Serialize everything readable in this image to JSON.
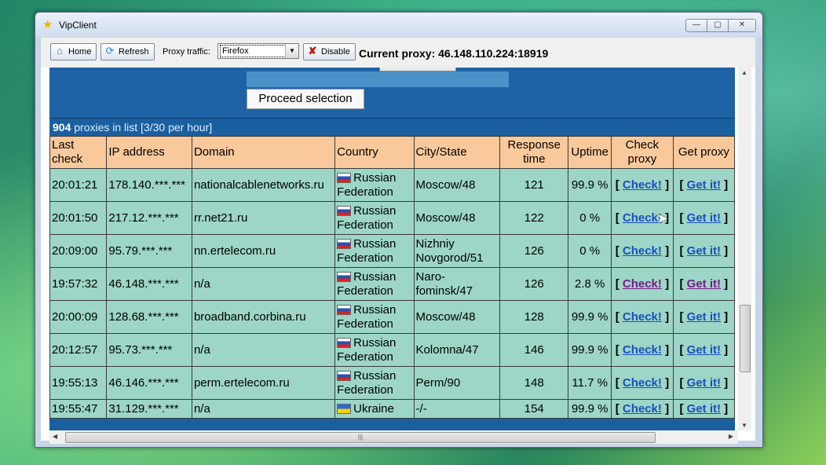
{
  "window": {
    "title": "VipClient",
    "controls": {
      "minimize": "—",
      "maximize": "▢",
      "close": "✕"
    }
  },
  "toolbar": {
    "home_label": "Home",
    "refresh_label": "Refresh",
    "proxy_traffic_label": "Proxy traffic:",
    "proxy_traffic_value": "Firefox",
    "disable_label": "Disable",
    "current_proxy": "Current proxy: 46.148.110.224:18919"
  },
  "panel": {
    "proceed_label": "Proceed selection",
    "proxy_count": "904",
    "proxy_count_suffix": " proxies in list [3/30 per hour]"
  },
  "table": {
    "headers": {
      "last_check": "Last check",
      "ip": "IP address",
      "domain": "Domain",
      "country": "Country",
      "city": "City/State",
      "response": "Response time",
      "uptime": "Uptime",
      "check": "Check proxy",
      "get": "Get proxy"
    },
    "link_check": "Check!",
    "link_get": "Get it!",
    "rows": [
      {
        "time": "20:01:21",
        "ip": "178.140.***.***",
        "domain": "nationalcablenetworks.ru",
        "country": "Russian Federation",
        "flag": "ru",
        "city": "Moscow/48",
        "response": "121",
        "uptime": "99.9 %"
      },
      {
        "time": "20:01:50",
        "ip": "217.12.***.***",
        "domain": "rr.net21.ru",
        "country": "Russian Federation",
        "flag": "ru",
        "city": "Moscow/48",
        "response": "122",
        "uptime": "0 %"
      },
      {
        "time": "20:09:00",
        "ip": "95.79.***.***",
        "domain": "nn.ertelecom.ru",
        "country": "Russian Federation",
        "flag": "ru",
        "city": "Nizhniy Novgorod/51",
        "response": "126",
        "uptime": "0 %"
      },
      {
        "time": "19:57:32",
        "ip": "46.148.***.***",
        "domain": "n/a",
        "country": "Russian Federation",
        "flag": "ru",
        "city": "Naro-fominsk/47",
        "response": "126",
        "uptime": "2.8 %"
      },
      {
        "time": "20:00:09",
        "ip": "128.68.***.***",
        "domain": "broadband.corbina.ru",
        "country": "Russian Federation",
        "flag": "ru",
        "city": "Moscow/48",
        "response": "128",
        "uptime": "99.9 %"
      },
      {
        "time": "20:12:57",
        "ip": "95.73.***.***",
        "domain": "n/a",
        "country": "Russian Federation",
        "flag": "ru",
        "city": "Kolomna/47",
        "response": "146",
        "uptime": "99.9 %"
      },
      {
        "time": "19:55:13",
        "ip": "46.146.***.***",
        "domain": "perm.ertelecom.ru",
        "country": "Russian Federation",
        "flag": "ru",
        "city": "Perm/90",
        "response": "148",
        "uptime": "11.7 %"
      },
      {
        "time": "19:55:47",
        "ip": "31.129.***.***",
        "domain": "n/a",
        "country": "Ukraine",
        "flag": "ua",
        "city": "-/-",
        "response": "154",
        "uptime": "99.9 %"
      }
    ]
  },
  "colors": {
    "panel_blue": "#1a5fa0",
    "header_bg": "#f9c99c",
    "row_bg": "#9dd6c6",
    "link": "#1a4fc0",
    "visited_link": "#7a1a8a"
  }
}
